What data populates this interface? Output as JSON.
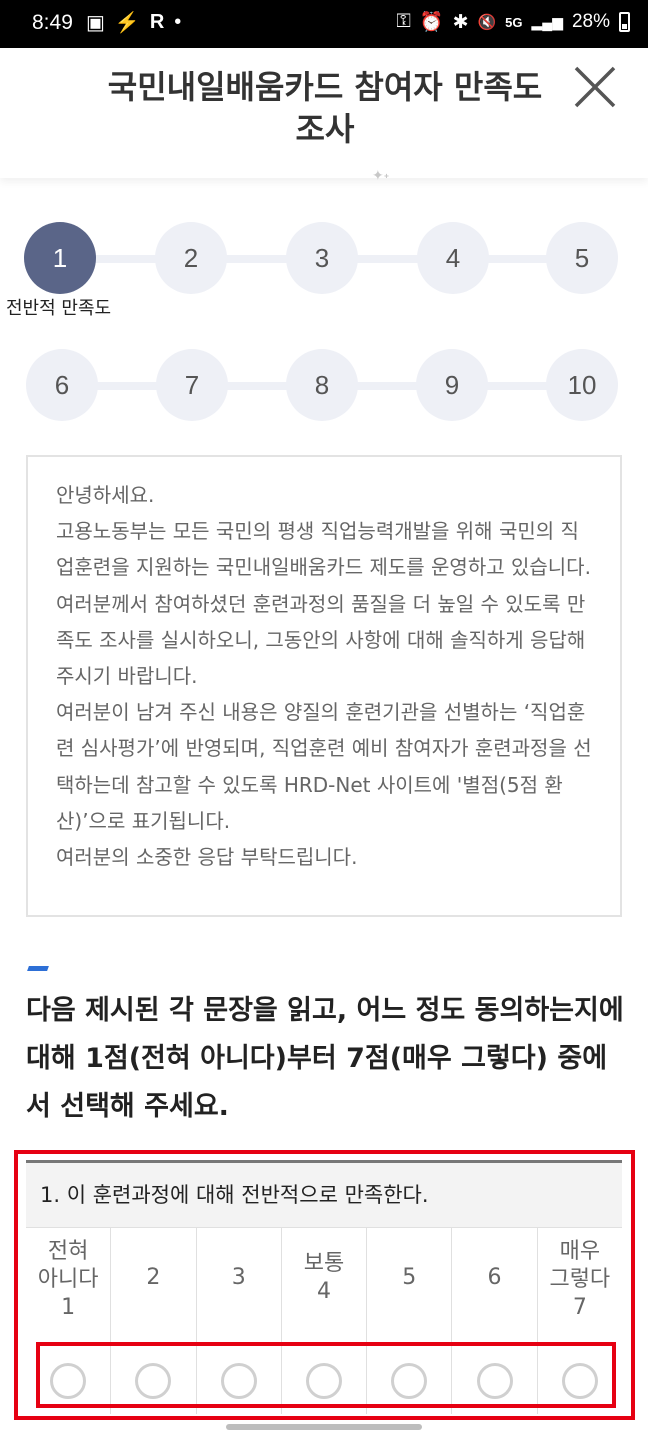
{
  "status_bar": {
    "time": "8:49",
    "left_icons": [
      "gallery-icon",
      "nfc-icon",
      "r-icon",
      "dot-icon"
    ],
    "left_glyphs": [
      "▣",
      "⚡",
      "R",
      "•"
    ],
    "right_icons": [
      "key-icon",
      "alarm-icon",
      "bluetooth-icon",
      "mute-icon",
      "5g-icon",
      "signal-icon"
    ],
    "right_glyphs": [
      "⚿",
      "⏰",
      "✱",
      "🔇",
      "5G",
      "▂▄▆"
    ],
    "battery": "28%"
  },
  "header": {
    "title": "국민내일배움카드 참여자 만족도 조사",
    "close_icon": "close-icon"
  },
  "steps": {
    "row1": [
      "1",
      "2",
      "3",
      "4",
      "5"
    ],
    "row2": [
      "6",
      "7",
      "8",
      "9",
      "10"
    ],
    "active_label": "전반적 만족도"
  },
  "notice": {
    "lines": [
      "안녕하세요.",
      "고용노동부는 모든 국민의 평생 직업능력개발을 위해 국민의 직업훈련을 지원하는 국민내일배움카드 제도를 운영하고 있습니다.",
      "여러분께서 참여하셨던 훈련과정의 품질을 더 높일 수 있도록 만족도 조사를 실시하오니, 그동안의 사항에 대해 솔직하게 응답해 주시기 바랍니다.",
      "여러분이 남겨 주신 내용은 양질의 훈련기관을 선별하는 ‘직업훈련 심사평가’에 반영되며, 직업훈련 예비 참여자가 훈련과정을 선택하는데 참고할 수 있도록 HRD-Net 사이트에 '별점(5점 환산)’으로 표기됩니다.",
      "여러분의 소중한 응답 부탁드립니다."
    ]
  },
  "instruction": "다음 제시된 각 문장을 읽고, 어느 정도 동의하는지에 대해 1점(전혀 아니다)부터 7점(매우 그렇다) 중에서 선택해 주세요.",
  "question": {
    "text": "1. 이 훈련과정에 대해 전반적으로 만족한다.",
    "scale": [
      {
        "label": "전혀\n아니다\n1"
      },
      {
        "label": "2"
      },
      {
        "label": "3"
      },
      {
        "label": "보통\n4"
      },
      {
        "label": "5"
      },
      {
        "label": "6"
      },
      {
        "label": "매우\n그렇다\n7"
      }
    ]
  }
}
